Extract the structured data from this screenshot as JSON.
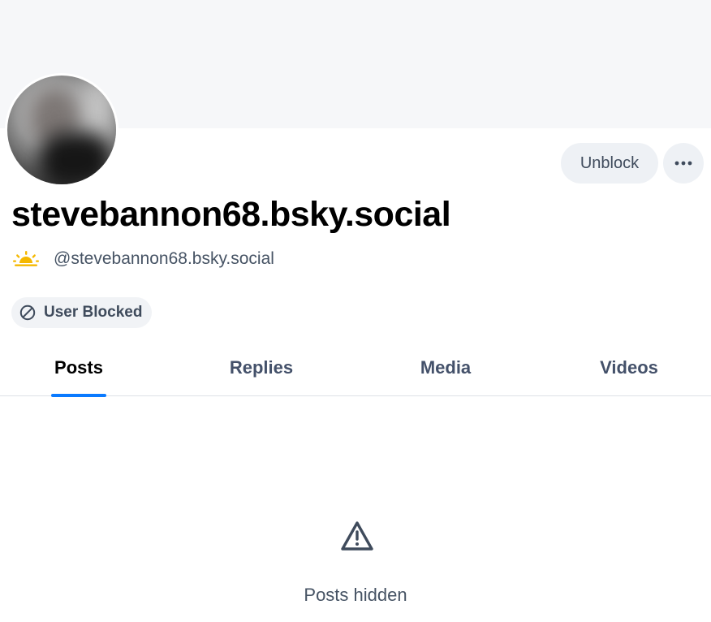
{
  "profile": {
    "display_name": "stevebannon68.bsky.social",
    "handle": "@stevebannon68.bsky.social",
    "avatar_icon": "profile-avatar",
    "handle_icon": "sunrise-icon"
  },
  "actions": {
    "unblock_label": "Unblock",
    "more_icon": "ellipsis-icon"
  },
  "status": {
    "blocked_label": "User Blocked",
    "blocked_icon": "ban-icon"
  },
  "tabs": [
    {
      "label": "Posts",
      "active": true
    },
    {
      "label": "Replies",
      "active": false
    },
    {
      "label": "Media",
      "active": false
    },
    {
      "label": "Videos",
      "active": false
    }
  ],
  "empty_state": {
    "icon": "warning-icon",
    "message": "Posts hidden"
  },
  "colors": {
    "accent": "#0a7aff",
    "banner": "#f6f7f9",
    "button_bg": "#eef1f5",
    "sun": "#f5b800"
  }
}
